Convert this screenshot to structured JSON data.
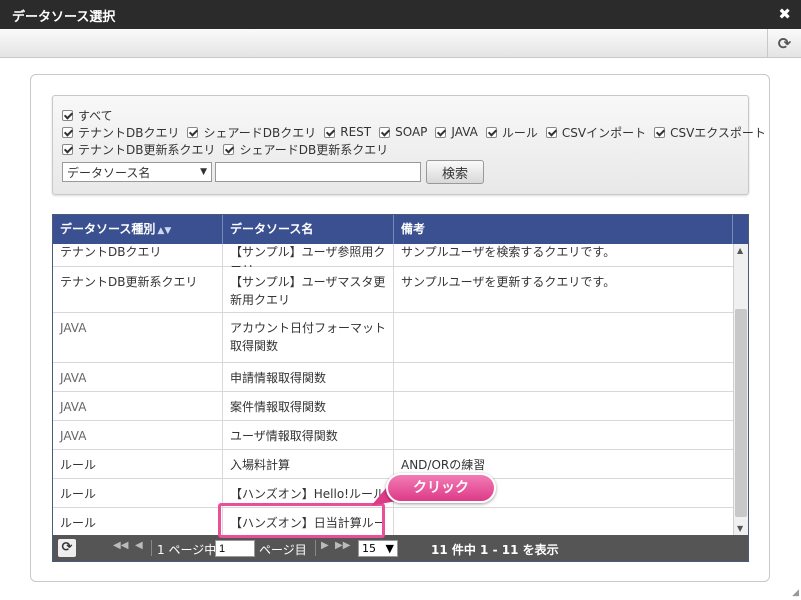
{
  "window": {
    "title": "データソース選択",
    "close_glyph": "✖",
    "refresh_glyph": "⟳"
  },
  "filter": {
    "row1": [
      "すべて"
    ],
    "row2": [
      "テナントDBクエリ",
      "シェアードDBクエリ",
      "REST",
      "SOAP",
      "JAVA",
      "ルール",
      "CSVインポート",
      "CSVエクスポート"
    ],
    "row3": [
      "テナントDB更新系クエリ",
      "シェアードDB更新系クエリ"
    ],
    "select_value": "データソース名",
    "search_value": "",
    "search_button": "検索"
  },
  "grid": {
    "columns": [
      "データソース種別",
      "データソース名",
      "備考"
    ],
    "rows": [
      {
        "type": "テナントDBクエリ",
        "name": "【サンプル】ユーザ参照用クエリ",
        "note": "サンプルユーザを検索するクエリです。"
      },
      {
        "type": "テナントDB更新系クエリ",
        "name": "【サンプル】ユーザマスタ更新用クエリ",
        "note": "サンプルユーザを更新するクエリです。"
      },
      {
        "type": "JAVA",
        "name": "アカウント日付フォーマット取得関数",
        "note": ""
      },
      {
        "type": "JAVA",
        "name": "申請情報取得関数",
        "note": ""
      },
      {
        "type": "JAVA",
        "name": "案件情報取得関数",
        "note": ""
      },
      {
        "type": "JAVA",
        "name": "ユーザ情報取得関数",
        "note": ""
      },
      {
        "type": "ルール",
        "name": "入場料計算",
        "note": "AND/ORの練習"
      },
      {
        "type": "ルール",
        "name": "【ハンズオン】Hello!ルール",
        "note": ""
      },
      {
        "type": "ルール",
        "name": "【ハンズオン】日当計算ルール",
        "note": ""
      }
    ],
    "pager": {
      "page_prefix": "1 ページ中",
      "page_value": "1",
      "page_suffix": "ページ目",
      "page_size": "15",
      "summary": "11 件中 1 - 11 を表示"
    }
  },
  "callout": {
    "label": "クリック"
  }
}
